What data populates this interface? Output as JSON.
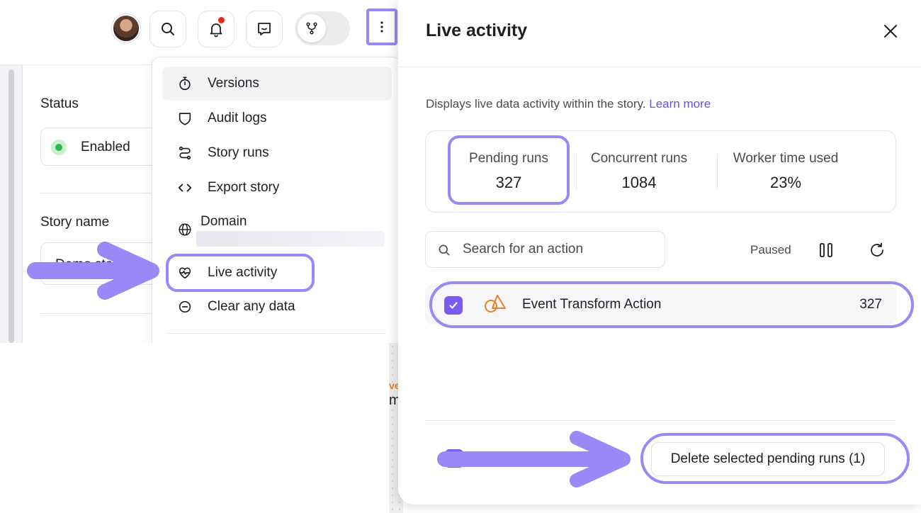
{
  "topbar": {
    "avatar_alt": "User avatar",
    "icons": [
      "search-icon",
      "bell-icon",
      "chat-icon",
      "branch-icon",
      "more-vertical-icon"
    ]
  },
  "settings": {
    "status_label": "Status",
    "status_value": "Enabled",
    "story_name_label": "Story name",
    "story_name_value": "Demo sto"
  },
  "menu": {
    "items": [
      {
        "label": "Versions",
        "icon": "stopwatch-icon"
      },
      {
        "label": "Audit logs",
        "icon": "shield-icon"
      },
      {
        "label": "Story runs",
        "icon": "route-icon"
      },
      {
        "label": "Export story",
        "icon": "code-icon"
      },
      {
        "label": "Domain",
        "icon": "globe-icon"
      },
      {
        "label": "Live activity",
        "icon": "heartbeat-icon"
      },
      {
        "label": "Clear any data",
        "icon": "minus-circle-icon"
      }
    ]
  },
  "canvas": {
    "frag1": "ve",
    "frag2": "m"
  },
  "panel": {
    "title": "Live activity",
    "description": "Displays live data activity within the story.",
    "learn_more": "Learn more",
    "stats": [
      {
        "label": "Pending runs",
        "value": "327"
      },
      {
        "label": "Concurrent runs",
        "value": "1084"
      },
      {
        "label": "Worker time used",
        "value": "23%"
      }
    ],
    "search_placeholder": "Search for an action",
    "paused_label": "Paused",
    "actions": [
      {
        "name": "Event Transform Action",
        "count": "327",
        "checked": true
      }
    ],
    "delete_button": "Delete selected pending runs (1)"
  },
  "colors": {
    "accent": "#9b87f5",
    "checkbox": "#7a5cf0",
    "status_green": "#2dbb4d",
    "notification_red": "#e8281b",
    "action_orange": "#e6812b",
    "link": "#6b4fe0"
  }
}
